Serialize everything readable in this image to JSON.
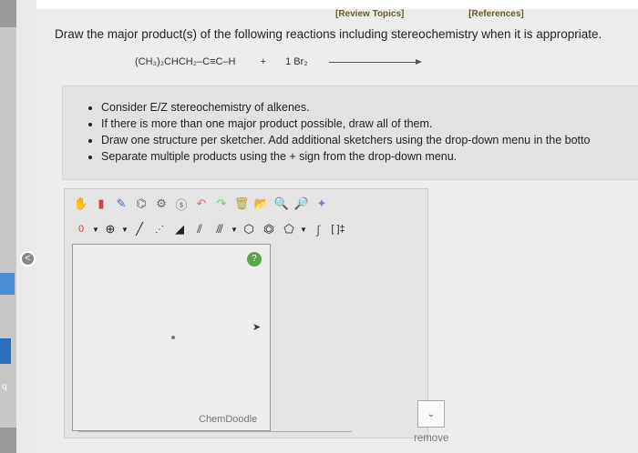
{
  "links": {
    "review": "[Review Topics]",
    "references": "[References]"
  },
  "instruction": "Draw the major product(s) of the following reactions including stereochemistry when it is appropriate.",
  "reaction": {
    "reactant": "(CH₃)₂CHCH₂–C≡C–H",
    "plus": "+",
    "reagent": "1 Br₂"
  },
  "hints": [
    "Consider E/Z stereochemistry of alkenes.",
    "If there is more than one major product possible, draw all of them.",
    "Draw one structure per sketcher. Add additional sketchers using the drop-down menu in the botto",
    "Separate multiple products using the + sign from the drop-down menu."
  ],
  "sketcher": {
    "toolbar_row1": [
      "hand-icon",
      "eraser-icon",
      "pencil-icon",
      "ring-template-icon",
      "chain-template-icon",
      "undo-icon",
      "redo-icon",
      "clear-icon",
      "open-icon",
      "zoom-in-icon",
      "zoom-out-icon",
      "clean-icon"
    ],
    "toolbar_row2": {
      "charge": "0",
      "add_atom": "⊕",
      "bond_tools": [
        "single-bond-icon",
        "stereo-bond-icon",
        "wedge-bond-icon",
        "double-bond-icon",
        "triple-bond-icon",
        "ring-benzene-icon",
        "ring-hexagon-icon",
        "ring-pentagon-icon",
        "fragment-icon",
        "bracket-icon"
      ]
    },
    "help": "?",
    "watermark": "ChemDoodle"
  },
  "remove_label": "remove",
  "left_number": "q"
}
